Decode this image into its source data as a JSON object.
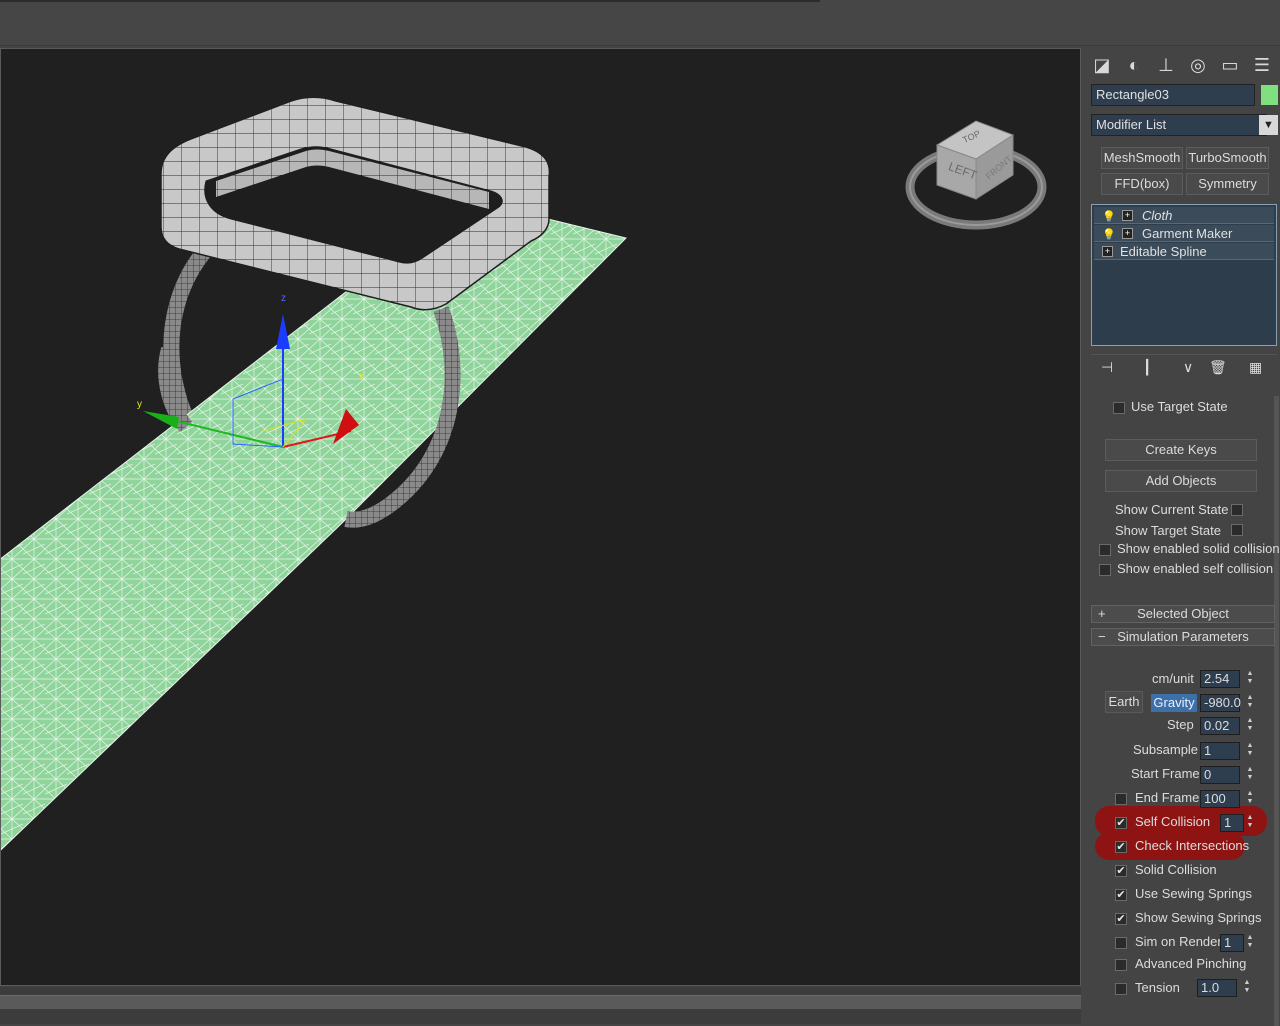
{
  "panel": {
    "object_name": "Rectangle03",
    "object_color": "#7ee07e",
    "modifier_list_label": "Modifier List",
    "modifier_buttons": [
      "MeshSmooth",
      "TurboSmooth",
      "FFD(box)",
      "Symmetry"
    ],
    "stack": [
      "Cloth",
      "Garment Maker",
      "Editable Spline"
    ],
    "use_target_state": "Use Target State",
    "create_keys": "Create Keys",
    "add_objects": "Add Objects",
    "show_current_state": "Show Current State",
    "show_target_state": "Show Target State",
    "show_enabled_solid": "Show enabled solid collision",
    "show_enabled_self": "Show enabled self collision",
    "rollout_selected": "Selected Object",
    "rollout_sim": "Simulation Parameters",
    "plus": "+",
    "minus": "−"
  },
  "sim": {
    "cm_unit_label": "cm/unit",
    "cm_unit_value": "2.54",
    "earth_label": "Earth",
    "gravity_label": "Gravity",
    "gravity_value": "-980.0",
    "step_label": "Step",
    "step_value": "0.02",
    "subsample_label": "Subsample",
    "subsample_value": "1",
    "start_frame_label": "Start Frame",
    "start_frame_value": "0",
    "end_frame_label": "End Frame",
    "end_frame_value": "100",
    "self_collision_label": "Self Collision",
    "self_collision_value": "1",
    "check_intersections_label": "Check Intersections",
    "solid_collision_label": "Solid Collision",
    "use_sewing_springs_label": "Use Sewing Springs",
    "show_sewing_springs_label": "Show Sewing Springs",
    "sim_on_render_label": "Sim on Render",
    "sim_on_render_value": "1",
    "advanced_pinching_label": "Advanced Pinching",
    "tension_label": "Tension",
    "tension_value": "1.0"
  },
  "viewcube": {
    "top": "TOP",
    "left": "LEFT",
    "front": "FRONT"
  },
  "gizmo": {
    "x": "x",
    "y": "y",
    "z": "z"
  },
  "check": "✔",
  "colors": {
    "cloth": "#8fd49a",
    "highlight": "#8e1414",
    "gravity_active": "#3d6fa8"
  }
}
